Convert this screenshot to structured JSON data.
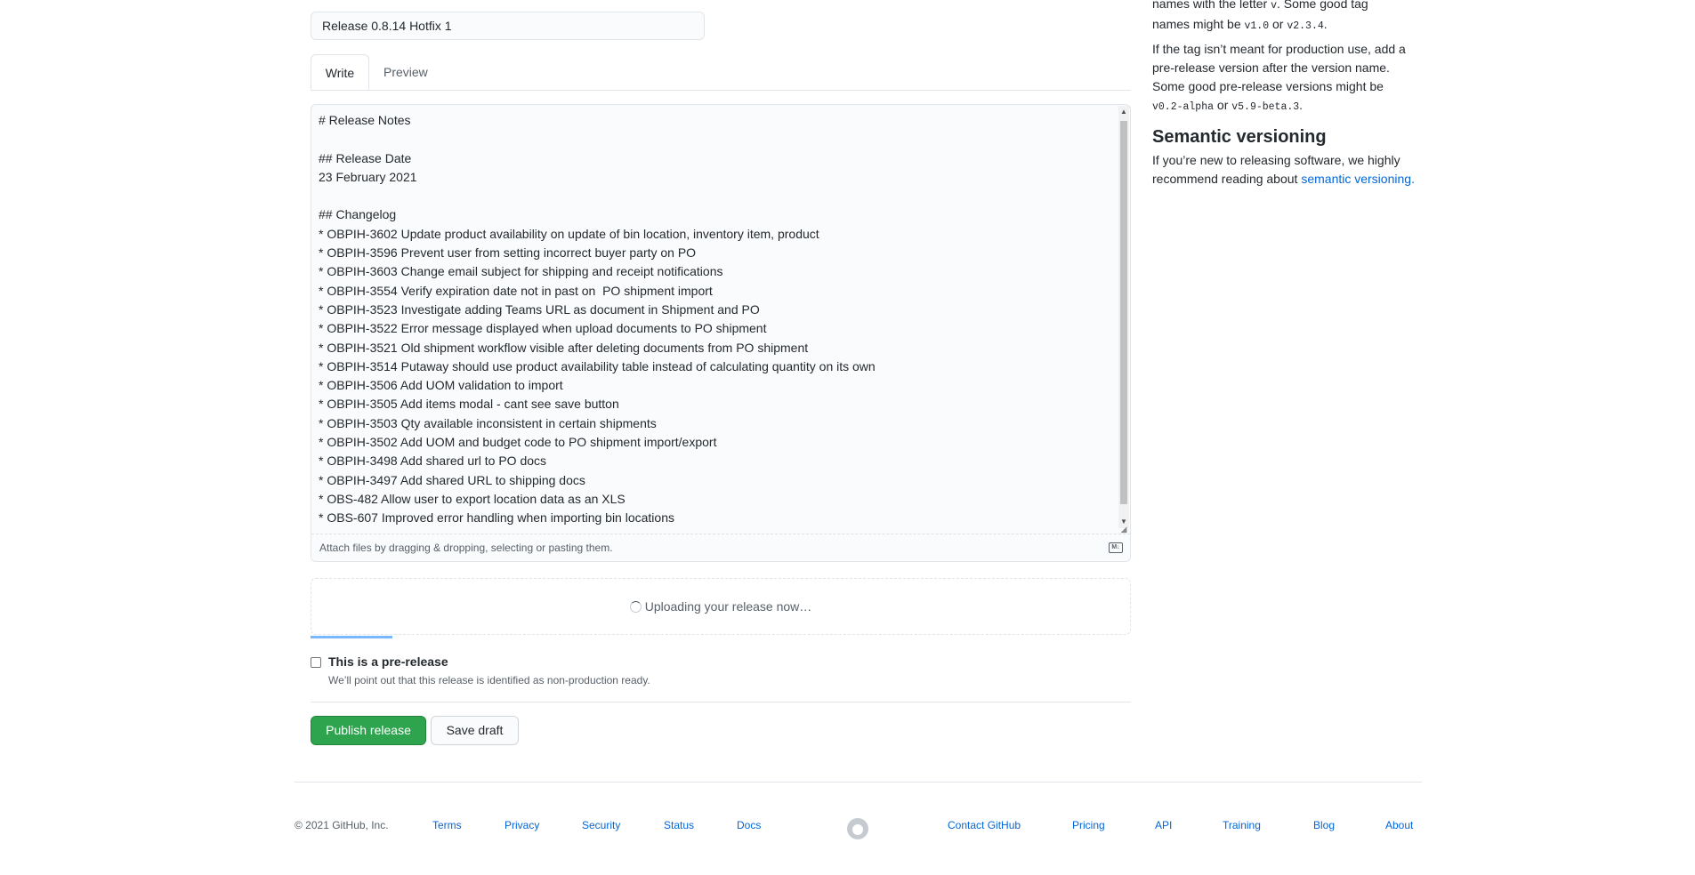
{
  "release": {
    "title_value": "Release 0.8.14 Hotfix 1",
    "tabs": [
      "Write",
      "Preview"
    ],
    "body_text": "# Release Notes\n\n## Release Date\n23 February 2021\n\n## Changelog\n* OBPIH-3602 Update product availability on update of bin location, inventory item, product\n* OBPIH-3596 Prevent user from setting incorrect buyer party on PO\n* OBPIH-3603 Change email subject for shipping and receipt notifications\n* OBPIH-3554 Verify expiration date not in past on  PO shipment import\n* OBPIH-3523 Investigate adding Teams URL as document in Shipment and PO\n* OBPIH-3522 Error message displayed when upload documents to PO shipment\n* OBPIH-3521 Old shipment workflow visible after deleting documents from PO shipment\n* OBPIH-3514 Putaway should use product availability table instead of calculating quantity on its own\n* OBPIH-3506 Add UOM validation to import\n* OBPIH-3505 Add items modal - cant see save button\n* OBPIH-3503 Qty available inconsistent in certain shipments\n* OBPIH-3502 Add UOM and budget code to PO shipment import/export\n* OBPIH-3498 Add shared url to PO docs\n* OBPIH-3497 Add shared URL to shipping docs\n* OBS-482 Allow user to export location data as an XLS\n* OBS-607 Improved error handling when importing bin locations",
    "attach_hint": "Attach files by dragging & dropping, selecting or pasting them.",
    "upload_status": "Uploading your release now…",
    "upload_progress_percent": 10,
    "prerelease_label": "This is a pre-release",
    "prerelease_note": "We’ll point out that this release is identified as non-production ready.",
    "prerelease_checked": false,
    "publish_label": "Publish release",
    "draft_label": "Save draft"
  },
  "sidebar": {
    "tag_tip_part1": "names with the letter ",
    "tag_tip_code_v": "v",
    "tag_tip_part2": ". Some good tag",
    "tag_tip_part3": "names might be ",
    "tag_code1": "v1.0",
    "or1": " or ",
    "tag_code2": "v2.3.4",
    "period": ".",
    "pre_tip": "If the tag isn’t meant for production use, add a pre-release version after the version name. Some good pre-release versions might be",
    "pre_code1": "v0.2-alpha",
    "or2": " or ",
    "pre_code2": "v5.9-beta.3",
    "semver_heading": "Semantic versioning",
    "semver_text": "If you’re new to releasing software, we highly recommend reading about ",
    "semver_link": "semantic versioning",
    "semver_end": "."
  },
  "footer": {
    "copyright": "© 2021 GitHub, Inc.",
    "left_links": [
      "Terms",
      "Privacy",
      "Security",
      "Status",
      "Docs"
    ],
    "right_links": [
      "Contact GitHub",
      "Pricing",
      "API",
      "Training",
      "Blog",
      "About"
    ]
  },
  "icons": [
    "loading-spinner-icon",
    "markdown-icon",
    "github-mark-icon",
    "scroll-up-arrow-icon",
    "scroll-down-arrow-icon",
    "resize-grip-icon"
  ]
}
